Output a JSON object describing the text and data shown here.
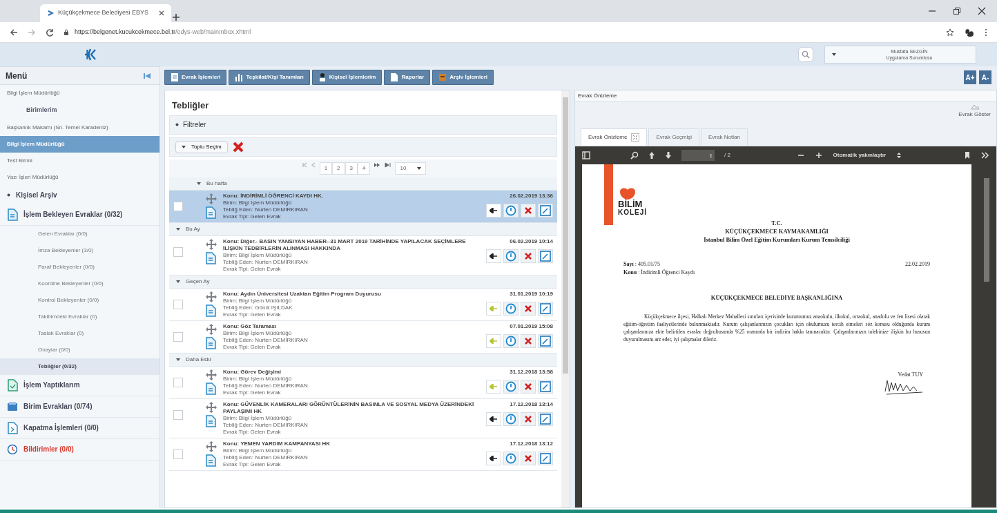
{
  "browser": {
    "tab_title": "Küçükçekmece Belediyesi EBYS",
    "url_host": "https://belgenet.kucukcekmece.bel.tr",
    "url_path": "/edys-web/mainInbox.xhtml"
  },
  "header": {
    "user_name": "Mustafa SEZGİN",
    "user_role": "Uygulama Sorumlusu"
  },
  "sidebar": {
    "title": "Menü",
    "unit": "Bilgi İşlem Müdürlüğü",
    "units_title": "Birimlerim",
    "units": [
      {
        "label": "Başkanlık Makamı (Sn. Temel Karadeniz)",
        "selected": false
      },
      {
        "label": "Bilgi İşlem Müdürlüğü",
        "selected": true
      },
      {
        "label": "Test Birimi",
        "selected": false
      },
      {
        "label": "Yazı İşleri Müdürlüğü",
        "selected": false
      }
    ],
    "archive": "Kişisel Arşiv",
    "menu": [
      {
        "label": "İşlem Bekleyen Evraklar (0/32)",
        "kind": "pending",
        "children": [
          {
            "label": "Gelen Evraklar (0/0)",
            "selected": false
          },
          {
            "label": "İmza Bekleyenler (3/0)",
            "selected": false
          },
          {
            "label": "Paraf Bekleyenler (0/0)",
            "selected": false
          },
          {
            "label": "Koordine Bekleyenler (0/0)",
            "selected": false
          },
          {
            "label": "Kontrol Bekleyenler (0/0)",
            "selected": false
          },
          {
            "label": "Takibimdeki Evraklar (0)",
            "selected": false
          },
          {
            "label": "Taslak Evraklar (0)",
            "selected": false
          },
          {
            "label": "Onaylar (0/0)",
            "selected": false
          },
          {
            "label": "Tebliğler (0/32)",
            "selected": true
          }
        ]
      },
      {
        "label": "İşlem Yaptıklarım",
        "kind": "done"
      },
      {
        "label": "Birim Evrakları (0/74)",
        "kind": "unit"
      },
      {
        "label": "Kapatma İşlemleri (0/0)",
        "kind": "closing"
      },
      {
        "label": "Bildirimler (0/0)",
        "kind": "alert"
      }
    ]
  },
  "toolbar": [
    {
      "label": "Evrak İşlemleri",
      "kind": "document"
    },
    {
      "label": "Teşkilat/Kişi Tanımları",
      "kind": "chart"
    },
    {
      "label": "Kişisel İşlemlerim",
      "kind": "person"
    },
    {
      "label": "Raporlar",
      "kind": "report"
    },
    {
      "label": "Arşiv İşlemleri",
      "kind": "archive"
    }
  ],
  "font_buttons": [
    "A+",
    "A-"
  ],
  "inbox": {
    "title": "Tebliğler",
    "filters": "Filtreler",
    "bulk": "Toplu Seçim",
    "pages": [
      "1",
      "2",
      "3",
      "4"
    ],
    "page_size": "10",
    "groups": [
      {
        "label": "Bu hafta",
        "rows": [
          {
            "subject": "Konu: İNDİRİMLİ ÖĞRENCİ KAYDI HK.",
            "unit": "Birim: Bilgi İşlem Müdürlüğü",
            "sender": "Tebliğ Eden: Nurten DEMİRKIRAN",
            "doc_type": "Evrak Tipi: Gelen Evrak",
            "date": "26.02.2019 13:36",
            "selected": true,
            "color": "#222222"
          }
        ]
      },
      {
        "label": "Bu Ay",
        "rows": [
          {
            "subject": "Konu: Diğer.- BASIN YANSIYAN HABER--31 MART 2019 TARİHİNDE YAPILACAK SEÇİMLERE İLİŞKİN TEDBİRLERİN ALINMASI HAKKINDA",
            "unit": "Birim: Bilgi İşlem Müdürlüğü",
            "sender": "Tebliğ Eden: Nurten DEMİRKIRAN",
            "doc_type": "Evrak Tipi: Gelen Evrak",
            "date": "06.02.2019 10:14",
            "selected": false,
            "color": "#222222"
          }
        ]
      },
      {
        "label": "Geçen Ay",
        "rows": [
          {
            "subject": "Konu: Aydın Üniversitesi Uzaktan Eğitim Program Duyurusu",
            "unit": "Birim: Bilgi İşlem Müdürlüğü",
            "sender": "Tebliğ Eden: Gönül IŞILDAK",
            "doc_type": "Evrak Tipi: Gelen Evrak",
            "date": "31.01.2019 10:19",
            "selected": false,
            "color": "#b8c43a"
          },
          {
            "subject": "Konu: Göz Taraması",
            "unit": "Birim: Bilgi İşlem Müdürlüğü",
            "sender": "Tebliğ Eden: Nurten DEMİRKIRAN",
            "doc_type": "Evrak Tipi: Gelen Evrak",
            "date": "07.01.2019 15:08",
            "selected": false,
            "color": "#b8c43a"
          }
        ]
      },
      {
        "label": "Daha Eski",
        "rows": [
          {
            "subject": "Konu: Görev Değişimi",
            "unit": "Birim: Bilgi İşlem Müdürlüğü",
            "sender": "Tebliğ Eden: Nurten DEMİRKIRAN",
            "doc_type": "Evrak Tipi: Gelen Evrak",
            "date": "31.12.2018 13:58",
            "selected": false,
            "color": "#b8c43a"
          },
          {
            "subject": "Konu: GÜVENLİK KAMERALARI GÖRÜNTÜLERİNİN BASINLA VE SOSYAL MEDYA ÜZERİNDEKİ PAYLAŞIMI HK",
            "unit": "Birim: Bilgi İşlem Müdürlüğü",
            "sender": "Tebliğ Eden: Nurten DEMİRKIRAN",
            "doc_type": "Evrak Tipi: Gelen Evrak",
            "date": "17.12.2018 13:14",
            "selected": false,
            "color": "#222222"
          },
          {
            "subject": "Konu: YEMEN YARDIM KAMPANYASI HK",
            "unit": "Birim: Bilgi İşlem Müdürlüğü",
            "sender": "Tebliğ Eden: Nurten DEMİRKIRAN",
            "doc_type": "Evrak Tipi: Gelen Evrak",
            "date": "17.12.2018 13:12",
            "selected": false,
            "color": "#222222"
          }
        ]
      }
    ]
  },
  "preview": {
    "title": "Evrak Önizleme",
    "show_button": "Evrak Göster",
    "tabs": [
      {
        "label": "Evrak Önizleme",
        "selected": true
      },
      {
        "label": "Evrak Geçmişi",
        "selected": false
      },
      {
        "label": "Evrak Notları",
        "selected": false
      }
    ],
    "pdf": {
      "page": "1",
      "total": "/ 2",
      "zoom": "Otomatik yakınlaştır"
    },
    "document": {
      "logo_line1": "BİLİM",
      "logo_line2": "KOLEJİ",
      "heading": [
        "T.C.",
        "KÜÇÜKÇEKMECE KAYMAKAMLIĞI",
        "İstanbul Bilim Özel Eğitim Kurumları Kurum Temsilciliği"
      ],
      "number": "**Sayı** : 405.01/75",
      "subject": "**Konu** : İndirimli Öğrenci Kaydı",
      "date": "22.02.2019",
      "addressee": "KÜÇÜKÇEKMECE BELEDİYE BAŞKANLIĞINA",
      "body": "Küçükçekmece ilçesi, Halkalı Merkez Mahallesi sınırları içerisinde kurumumuz anaokulu, ilkokul, ortaokul, anadolu ve fen lisesi olarak eğitim-öğretim faaliyetlerinde bulunmaktadır. Kurum çalışanlarınızın çocukları için okulumuzu tercih etmeleri söz konusu olduğunda kurum çalışanlarınıza ekte belirtilen esaslar doğrultusunda %25 oranında bir indirim hakkı tanınacaktır. Çalışanlarınızın talebinize ilişkin bu hususun duyurulmasını arz eder, iyi çalışmalar dileriz.",
      "signer": "Vedat TUY"
    }
  }
}
